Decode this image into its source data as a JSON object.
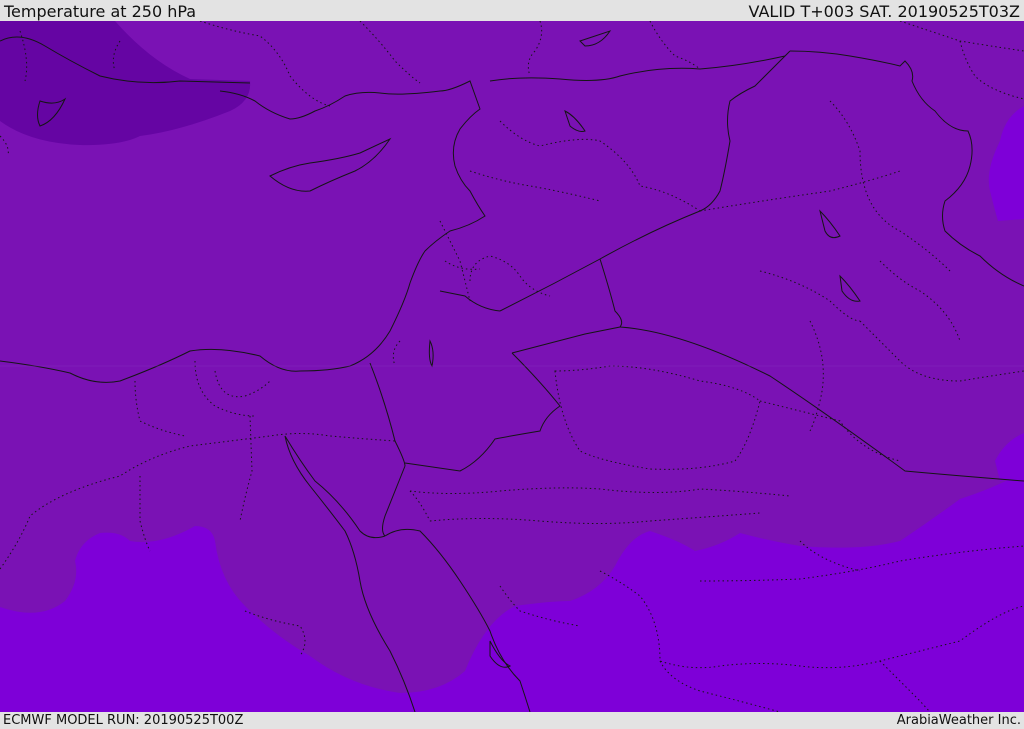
{
  "header": {
    "title": "Temperature at 250 hPa",
    "valid_time": "VALID T+003 SAT. 20190525T03Z"
  },
  "footer": {
    "model_run": "ECMWF MODEL RUN: 20190525T00Z",
    "provider": "ArabiaWeather Inc."
  },
  "map": {
    "colors": {
      "base": "#7a12b4",
      "cold": "#6505a3",
      "warm": "#7e00d8",
      "border": "#151515"
    }
  }
}
